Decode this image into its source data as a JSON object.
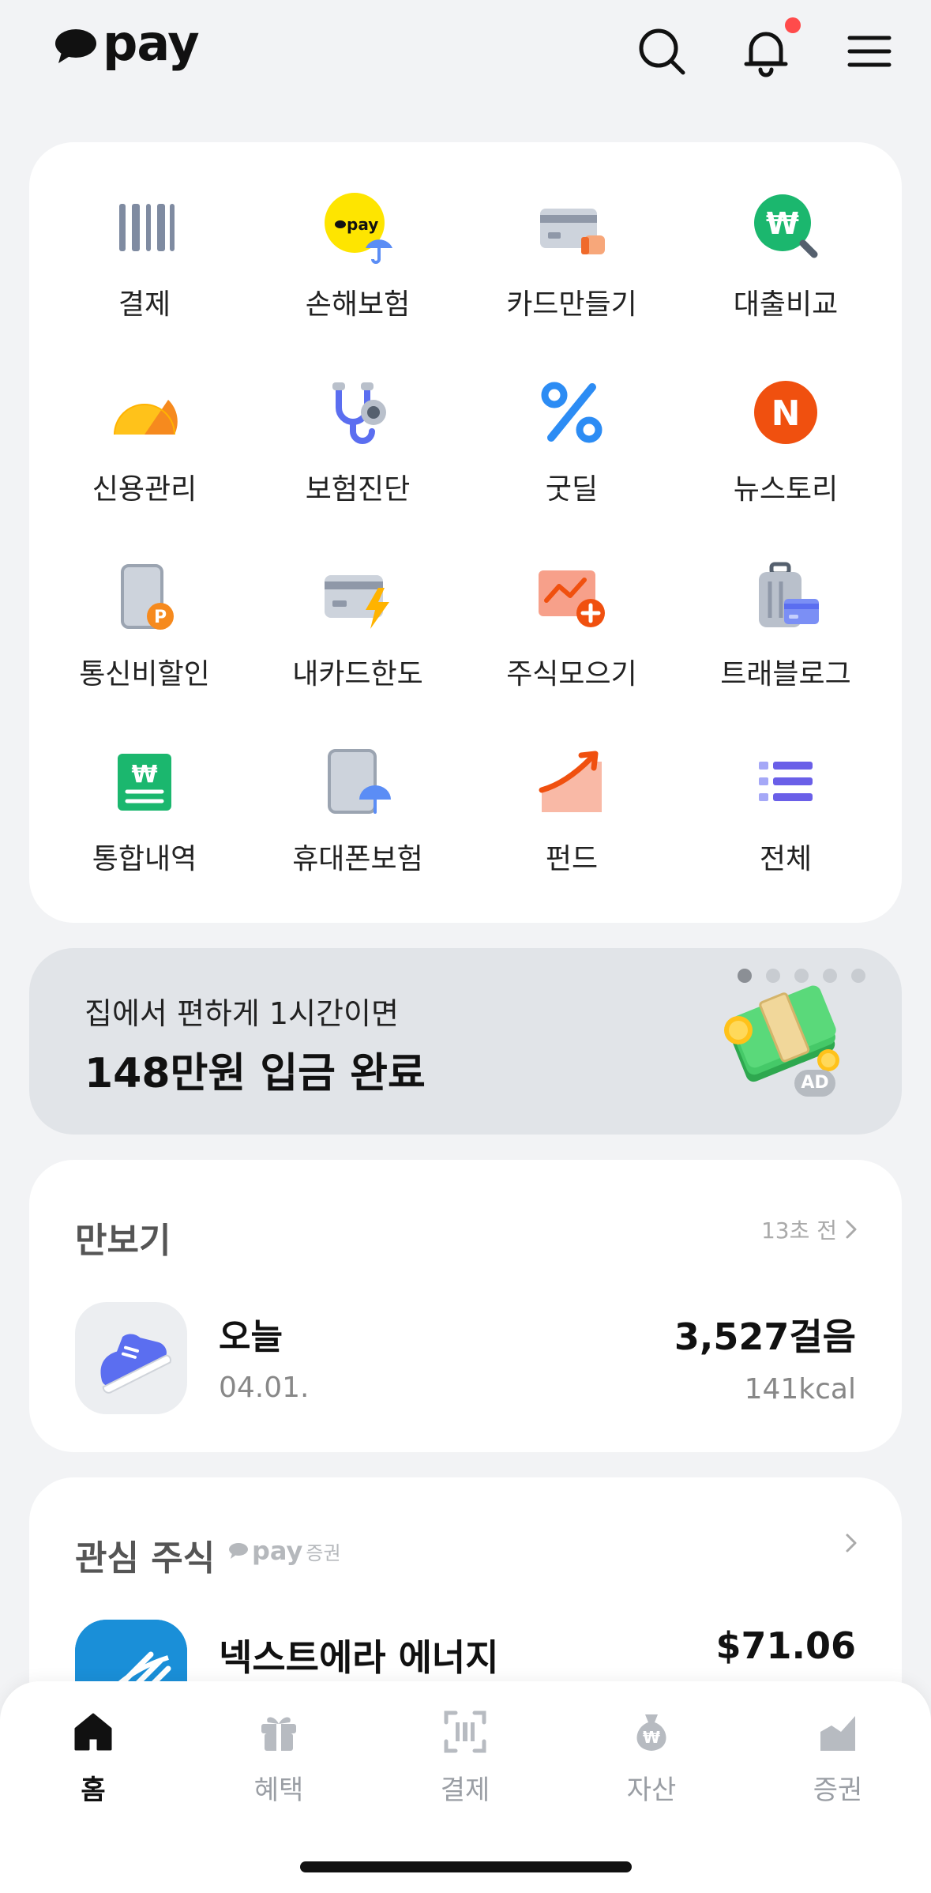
{
  "header": {
    "logo": "pay",
    "notification_dot_color": "#ff4b4b"
  },
  "menu": {
    "items": [
      {
        "label": "결제",
        "icon": "barcode-icon"
      },
      {
        "label": "손해보험",
        "icon": "pay-insurance-icon"
      },
      {
        "label": "카드만들기",
        "icon": "card-create-icon"
      },
      {
        "label": "대출비교",
        "icon": "loan-compare-icon"
      },
      {
        "label": "신용관리",
        "icon": "credit-gauge-icon"
      },
      {
        "label": "보험진단",
        "icon": "stethoscope-icon"
      },
      {
        "label": "굿딜",
        "icon": "percent-icon"
      },
      {
        "label": "뉴스토리",
        "icon": "news-icon"
      },
      {
        "label": "통신비할인",
        "icon": "phone-discount-icon"
      },
      {
        "label": "내카드한도",
        "icon": "card-limit-icon"
      },
      {
        "label": "주식모으기",
        "icon": "stock-collect-icon"
      },
      {
        "label": "트래블로그",
        "icon": "travel-icon"
      },
      {
        "label": "통합내역",
        "icon": "history-icon"
      },
      {
        "label": "휴대폰보험",
        "icon": "phone-insurance-icon"
      },
      {
        "label": "펀드",
        "icon": "fund-icon"
      },
      {
        "label": "전체",
        "icon": "list-icon"
      }
    ]
  },
  "banner": {
    "subtitle": "집에서 편하게 1시간이면",
    "title": "148만원 입금 완료",
    "ad": "AD",
    "page_count": 5,
    "active_page": 1
  },
  "steps": {
    "title": "만보기",
    "updated": "13초 전",
    "day": "오늘",
    "date": "04.01.",
    "count": "3,527걸음",
    "kcal": "141kcal"
  },
  "stocks": {
    "title": "관심 주식",
    "brand": "pay",
    "brand_suffix": "증권",
    "item_name": "넥스트에라 에너지",
    "item_price": "$71.06"
  },
  "nav": {
    "items": [
      {
        "label": "홈",
        "icon": "home-icon",
        "active": true
      },
      {
        "label": "혜택",
        "icon": "gift-icon",
        "active": false
      },
      {
        "label": "결제",
        "icon": "scan-pay-icon",
        "active": false
      },
      {
        "label": "자산",
        "icon": "money-bag-icon",
        "active": false
      },
      {
        "label": "증권",
        "icon": "stock-chart-icon",
        "active": false
      }
    ]
  },
  "colors": {
    "background": "#f2f3f5",
    "card": "#ffffff",
    "banner": "#e1e4e8",
    "kakao_yellow": "#fee500",
    "accent_blue": "#2c8cf4",
    "accent_orange": "#f25a1a",
    "accent_green": "#1bb76e"
  }
}
